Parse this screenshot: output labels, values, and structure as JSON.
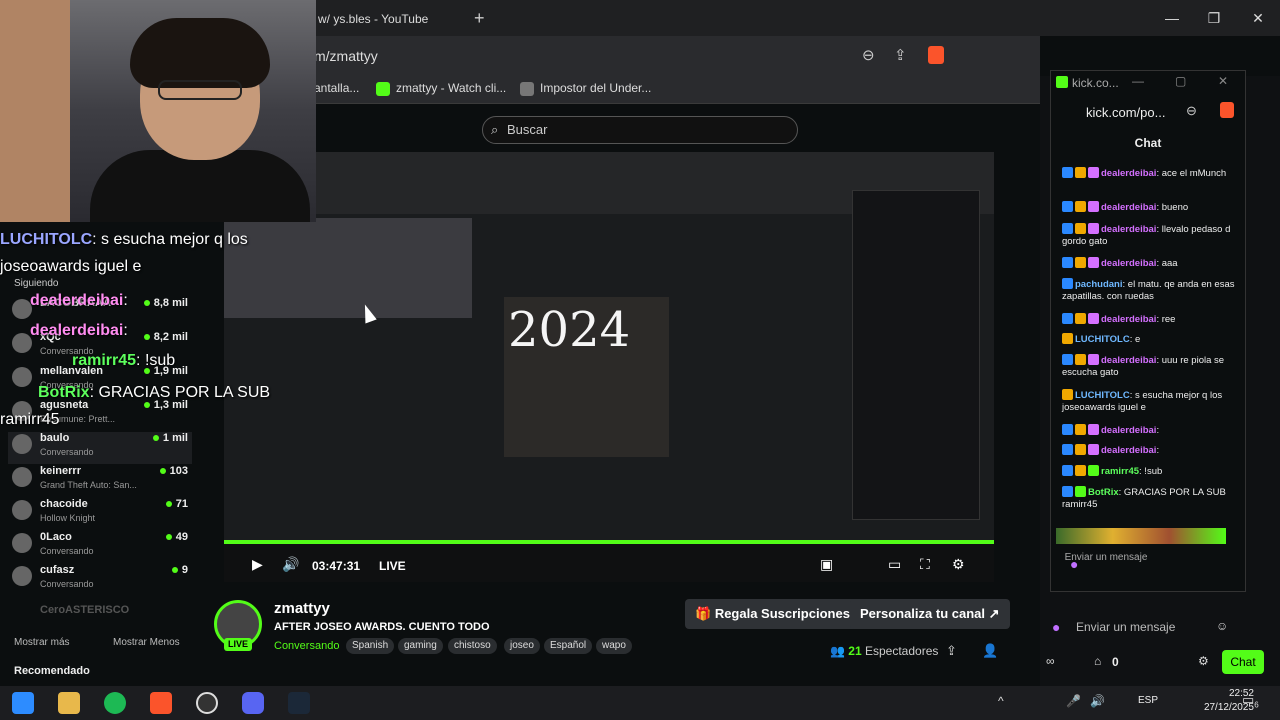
{
  "browser": {
    "tab_title": "w/ ys.bles - YouTube",
    "url": "m/zmattyy",
    "bookmarks": [
      "antalla...",
      "zmattyy - Watch cli...",
      "Impostor del Under..."
    ],
    "search_placeholder": "Buscar"
  },
  "overlay_chat": [
    {
      "user": "LUCHITOLC",
      "text": ": s esucha mejor q los"
    },
    {
      "user": "",
      "text": "joseoawards iguel e"
    },
    {
      "user": "dealerdeibai",
      "text": ":"
    },
    {
      "user": "dealerdeibai",
      "text": ":"
    },
    {
      "user": "ramirr45",
      "text": ": !sub"
    },
    {
      "user": "BotRix",
      "text": ": GRACIAS POR LA SUB"
    },
    {
      "user": "",
      "text": "ramirr45"
    }
  ],
  "sidebar": {
    "following_label": "Siguiendo",
    "items": [
      {
        "name": "LACOBRAAA",
        "sub": "",
        "count": "8,8 mil"
      },
      {
        "name": "xQc",
        "sub": "Conversando",
        "count": "8,2 mil"
      },
      {
        "name": "mellanvalen",
        "sub": "Conversando",
        "count": "1,9 mil"
      },
      {
        "name": "agusneta",
        "sub": "Resumune: Prett...",
        "count": "1,3 mil"
      },
      {
        "name": "baulo",
        "sub": "Conversando",
        "count": "1 mil"
      },
      {
        "name": "keinerrr",
        "sub": "Grand Theft Auto: San...",
        "count": "103"
      },
      {
        "name": "chacoide",
        "sub": "Hollow Knight",
        "count": "71"
      },
      {
        "name": "0Laco",
        "sub": "Conversando",
        "count": "49"
      },
      {
        "name": "cufasz",
        "sub": "Conversando",
        "count": "9"
      },
      {
        "name": "CeroASTERISCO",
        "sub": "",
        "count": ""
      }
    ],
    "show_more": "Mostrar más",
    "show_less": "Mostrar Menos",
    "recommended": "Recomendado"
  },
  "player": {
    "year_text": "2024",
    "timecode": "03:47:31",
    "live": "LIVE"
  },
  "stream_info": {
    "streamer": "zmattyy",
    "live_badge": "LIVE",
    "title": "AFTER JOSEO AWARDS. CUENTO TODO",
    "category": "Conversando",
    "tags": [
      "Spanish",
      "gaming",
      "chistoso",
      "joseo",
      "Español",
      "wapo"
    ],
    "gift_button": "Regala Suscripciones",
    "customize_button": "Personaliza tu canal",
    "viewers_count": "21",
    "viewers_label": "Espectadores"
  },
  "popup": {
    "title": "kick.co...",
    "url": "kick.com/po...",
    "chat_label": "Chat",
    "messages": [
      {
        "user": "dealerdeibai",
        "text": ": ace el mMunch",
        "c": "n"
      },
      {
        "user": "dealerdeibai",
        "text": ": bueno",
        "c": "n"
      },
      {
        "user": "dealerdeibai",
        "text": ": llevalo pedaso d gordo gato",
        "c": "n"
      },
      {
        "user": "dealerdeibai",
        "text": ": aaa",
        "c": "n"
      },
      {
        "user": "pachudani",
        "text": ": el matu. qe anda en esas zapatillas. con ruedas",
        "c": "n2"
      },
      {
        "user": "dealerdeibai",
        "text": ": ree",
        "c": "n"
      },
      {
        "user": "LUCHITOLC",
        "text": ": e",
        "c": "n2"
      },
      {
        "user": "dealerdeibai",
        "text": ": uuu re piola se escucha gato",
        "c": "n"
      },
      {
        "user": "LUCHITOLC",
        "text": ": s esucha mejor q los joseoawards iguel e",
        "c": "n2"
      },
      {
        "user": "dealerdeibai",
        "text": ":",
        "c": "n"
      },
      {
        "user": "dealerdeibai",
        "text": ":",
        "c": "n"
      },
      {
        "user": "ramirr45",
        "text": ": !sub",
        "c": "n3"
      },
      {
        "user": "BotRix",
        "text": ": GRACIAS POR LA SUB ramirr45",
        "c": "n3"
      }
    ],
    "input_placeholder": "Enviar un mensaje"
  },
  "right_panel": {
    "send_placeholder": "Enviar un mensaje",
    "points": "0",
    "chat_button": "Chat"
  },
  "taskbar": {
    "lang": "ESP",
    "time": "22:52",
    "date": "27/12/2025",
    "notif_count": "6"
  },
  "colors": {
    "kick_green": "#53fc18",
    "bg": "#0b0e0f"
  }
}
